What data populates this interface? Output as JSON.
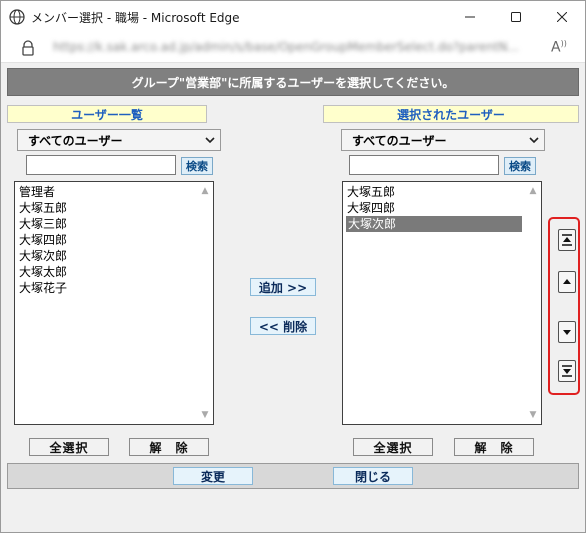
{
  "window": {
    "title": "メンバー選択 - 職場 - Microsoft Edge",
    "url": "https://k.sak.arco.ad.jp/admin/s/base/OpenGroupMemberSelect.do?parentN..."
  },
  "header": {
    "message": "グループ\"営業部\"に所属するユーザーを選択してください。"
  },
  "left_panel": {
    "title": "ユーザー一覧",
    "filter_selected": "すべてのユーザー",
    "search_value": "",
    "search_button": "検索",
    "items": [
      "管理者",
      "大塚五郎",
      "大塚三郎",
      "大塚四郎",
      "大塚次郎",
      "大塚太郎",
      "大塚花子"
    ],
    "select_all": "全選択",
    "deselect": "解　除"
  },
  "right_panel": {
    "title": "選択されたユーザー",
    "filter_selected": "すべてのユーザー",
    "search_value": "",
    "search_button": "検索",
    "items": [
      "大塚五郎",
      "大塚四郎",
      "大塚次郎"
    ],
    "selected_index": 2,
    "select_all": "全選択",
    "deselect": "解　除"
  },
  "actions": {
    "add": "追加 >>",
    "remove": "<< 削除"
  },
  "order_buttons": [
    "move-top-icon",
    "move-up-icon",
    "move-down-icon",
    "move-bottom-icon"
  ],
  "footer": {
    "change": "変更",
    "close": "閉じる"
  },
  "colors": {
    "header_bg": "#808080",
    "label_bg": "#ffffcc",
    "label_text": "#1f5fbf",
    "highlight_frame": "#e02020",
    "selected_item_bg": "#7a7a7a"
  }
}
